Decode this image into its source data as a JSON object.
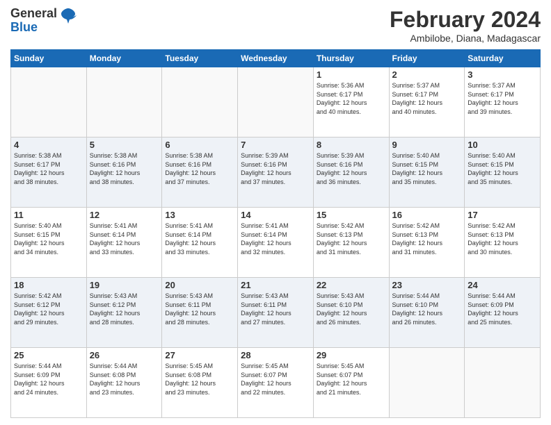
{
  "header": {
    "logo_line1": "General",
    "logo_line2": "Blue",
    "month_year": "February 2024",
    "location": "Ambilobe, Diana, Madagascar"
  },
  "days_of_week": [
    "Sunday",
    "Monday",
    "Tuesday",
    "Wednesday",
    "Thursday",
    "Friday",
    "Saturday"
  ],
  "weeks": [
    [
      {
        "day": "",
        "info": ""
      },
      {
        "day": "",
        "info": ""
      },
      {
        "day": "",
        "info": ""
      },
      {
        "day": "",
        "info": ""
      },
      {
        "day": "1",
        "info": "Sunrise: 5:36 AM\nSunset: 6:17 PM\nDaylight: 12 hours\nand 40 minutes."
      },
      {
        "day": "2",
        "info": "Sunrise: 5:37 AM\nSunset: 6:17 PM\nDaylight: 12 hours\nand 40 minutes."
      },
      {
        "day": "3",
        "info": "Sunrise: 5:37 AM\nSunset: 6:17 PM\nDaylight: 12 hours\nand 39 minutes."
      }
    ],
    [
      {
        "day": "4",
        "info": "Sunrise: 5:38 AM\nSunset: 6:17 PM\nDaylight: 12 hours\nand 38 minutes."
      },
      {
        "day": "5",
        "info": "Sunrise: 5:38 AM\nSunset: 6:16 PM\nDaylight: 12 hours\nand 38 minutes."
      },
      {
        "day": "6",
        "info": "Sunrise: 5:38 AM\nSunset: 6:16 PM\nDaylight: 12 hours\nand 37 minutes."
      },
      {
        "day": "7",
        "info": "Sunrise: 5:39 AM\nSunset: 6:16 PM\nDaylight: 12 hours\nand 37 minutes."
      },
      {
        "day": "8",
        "info": "Sunrise: 5:39 AM\nSunset: 6:16 PM\nDaylight: 12 hours\nand 36 minutes."
      },
      {
        "day": "9",
        "info": "Sunrise: 5:40 AM\nSunset: 6:15 PM\nDaylight: 12 hours\nand 35 minutes."
      },
      {
        "day": "10",
        "info": "Sunrise: 5:40 AM\nSunset: 6:15 PM\nDaylight: 12 hours\nand 35 minutes."
      }
    ],
    [
      {
        "day": "11",
        "info": "Sunrise: 5:40 AM\nSunset: 6:15 PM\nDaylight: 12 hours\nand 34 minutes."
      },
      {
        "day": "12",
        "info": "Sunrise: 5:41 AM\nSunset: 6:14 PM\nDaylight: 12 hours\nand 33 minutes."
      },
      {
        "day": "13",
        "info": "Sunrise: 5:41 AM\nSunset: 6:14 PM\nDaylight: 12 hours\nand 33 minutes."
      },
      {
        "day": "14",
        "info": "Sunrise: 5:41 AM\nSunset: 6:14 PM\nDaylight: 12 hours\nand 32 minutes."
      },
      {
        "day": "15",
        "info": "Sunrise: 5:42 AM\nSunset: 6:13 PM\nDaylight: 12 hours\nand 31 minutes."
      },
      {
        "day": "16",
        "info": "Sunrise: 5:42 AM\nSunset: 6:13 PM\nDaylight: 12 hours\nand 31 minutes."
      },
      {
        "day": "17",
        "info": "Sunrise: 5:42 AM\nSunset: 6:13 PM\nDaylight: 12 hours\nand 30 minutes."
      }
    ],
    [
      {
        "day": "18",
        "info": "Sunrise: 5:42 AM\nSunset: 6:12 PM\nDaylight: 12 hours\nand 29 minutes."
      },
      {
        "day": "19",
        "info": "Sunrise: 5:43 AM\nSunset: 6:12 PM\nDaylight: 12 hours\nand 28 minutes."
      },
      {
        "day": "20",
        "info": "Sunrise: 5:43 AM\nSunset: 6:11 PM\nDaylight: 12 hours\nand 28 minutes."
      },
      {
        "day": "21",
        "info": "Sunrise: 5:43 AM\nSunset: 6:11 PM\nDaylight: 12 hours\nand 27 minutes."
      },
      {
        "day": "22",
        "info": "Sunrise: 5:43 AM\nSunset: 6:10 PM\nDaylight: 12 hours\nand 26 minutes."
      },
      {
        "day": "23",
        "info": "Sunrise: 5:44 AM\nSunset: 6:10 PM\nDaylight: 12 hours\nand 26 minutes."
      },
      {
        "day": "24",
        "info": "Sunrise: 5:44 AM\nSunset: 6:09 PM\nDaylight: 12 hours\nand 25 minutes."
      }
    ],
    [
      {
        "day": "25",
        "info": "Sunrise: 5:44 AM\nSunset: 6:09 PM\nDaylight: 12 hours\nand 24 minutes."
      },
      {
        "day": "26",
        "info": "Sunrise: 5:44 AM\nSunset: 6:08 PM\nDaylight: 12 hours\nand 23 minutes."
      },
      {
        "day": "27",
        "info": "Sunrise: 5:45 AM\nSunset: 6:08 PM\nDaylight: 12 hours\nand 23 minutes."
      },
      {
        "day": "28",
        "info": "Sunrise: 5:45 AM\nSunset: 6:07 PM\nDaylight: 12 hours\nand 22 minutes."
      },
      {
        "day": "29",
        "info": "Sunrise: 5:45 AM\nSunset: 6:07 PM\nDaylight: 12 hours\nand 21 minutes."
      },
      {
        "day": "",
        "info": ""
      },
      {
        "day": "",
        "info": ""
      }
    ]
  ]
}
